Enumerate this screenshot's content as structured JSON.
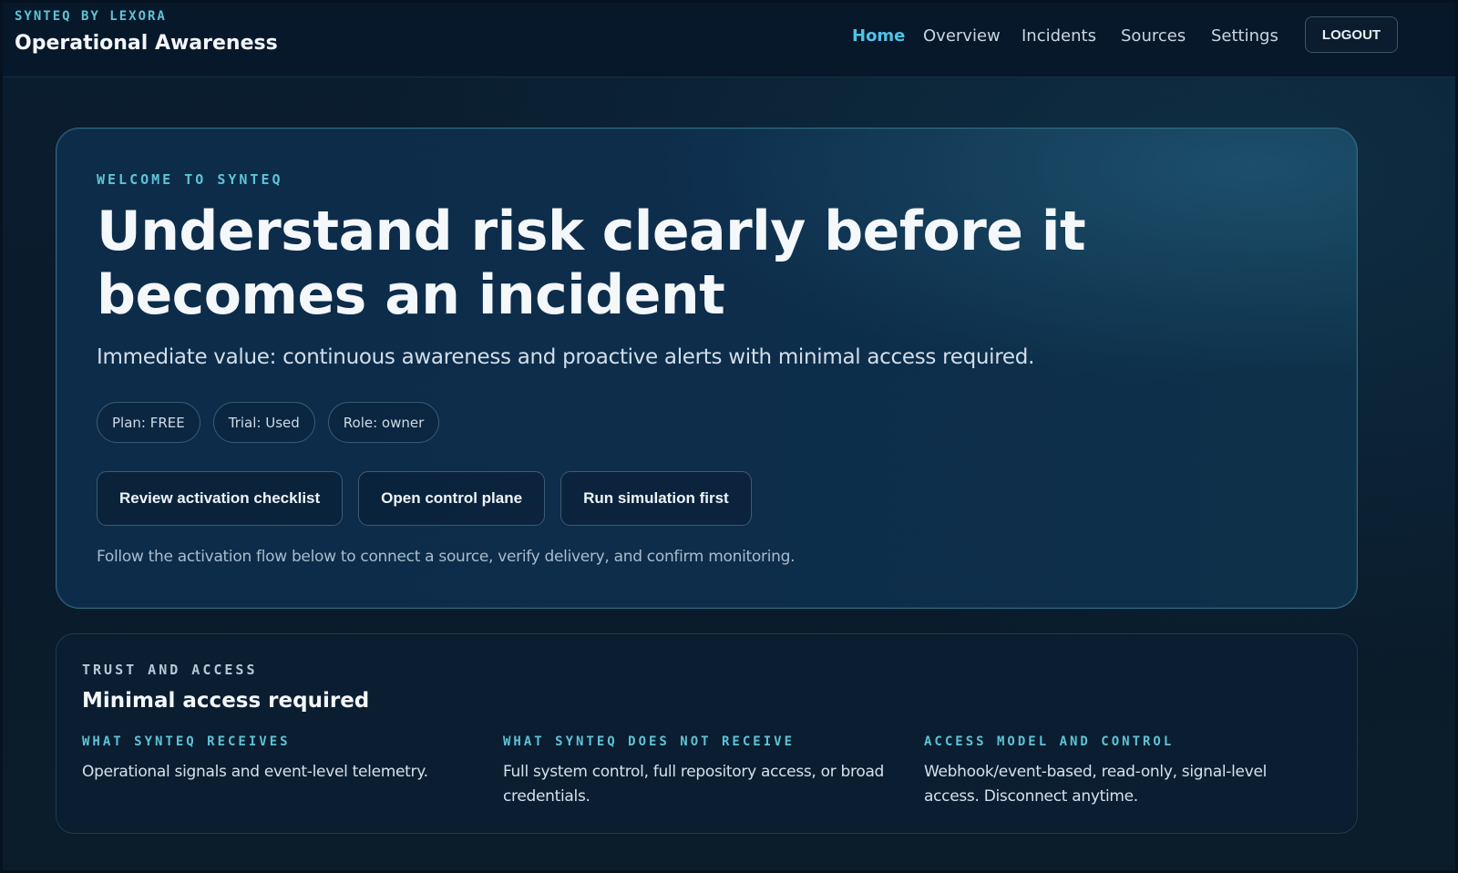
{
  "header": {
    "brand_kicker": "SYNTEQ BY LEXORA",
    "brand_title": "Operational Awareness",
    "nav": [
      "Home",
      "Overview",
      "Incidents",
      "Sources",
      "Settings"
    ],
    "active_nav": "Home",
    "logout_label": "LOGOUT"
  },
  "hero": {
    "kicker": "WELCOME TO SYNTEQ",
    "title_line1": "Understand risk clearly before it",
    "title_line2": "becomes an incident",
    "subtitle": "Immediate value: continuous awareness and proactive alerts with minimal access required.",
    "pills": [
      "Plan: FREE",
      "Trial: Used",
      "Role: owner"
    ],
    "actions": [
      "Review activation checklist",
      "Open control plane",
      "Run simulation first"
    ],
    "note": "Follow the activation flow below to connect a source, verify delivery, and confirm monitoring."
  },
  "trust": {
    "kicker": "TRUST AND ACCESS",
    "title": "Minimal access required",
    "columns": [
      {
        "heading": "WHAT SYNTEQ RECEIVES",
        "text": "Operational signals and event-level telemetry."
      },
      {
        "heading": "WHAT SYNTEQ DOES NOT RECEIVE",
        "text": "Full system control, full repository access, or broad credentials."
      },
      {
        "heading": "ACCESS MODEL AND CONTROL",
        "text": "Webhook/event-based, read-only, signal-level access. Disconnect anytime."
      }
    ]
  },
  "colors": {
    "accent": "#4fc3e6",
    "kicker": "#5fc3d6",
    "background": "#0a1b2b",
    "hero_border": "#2f6b83"
  }
}
